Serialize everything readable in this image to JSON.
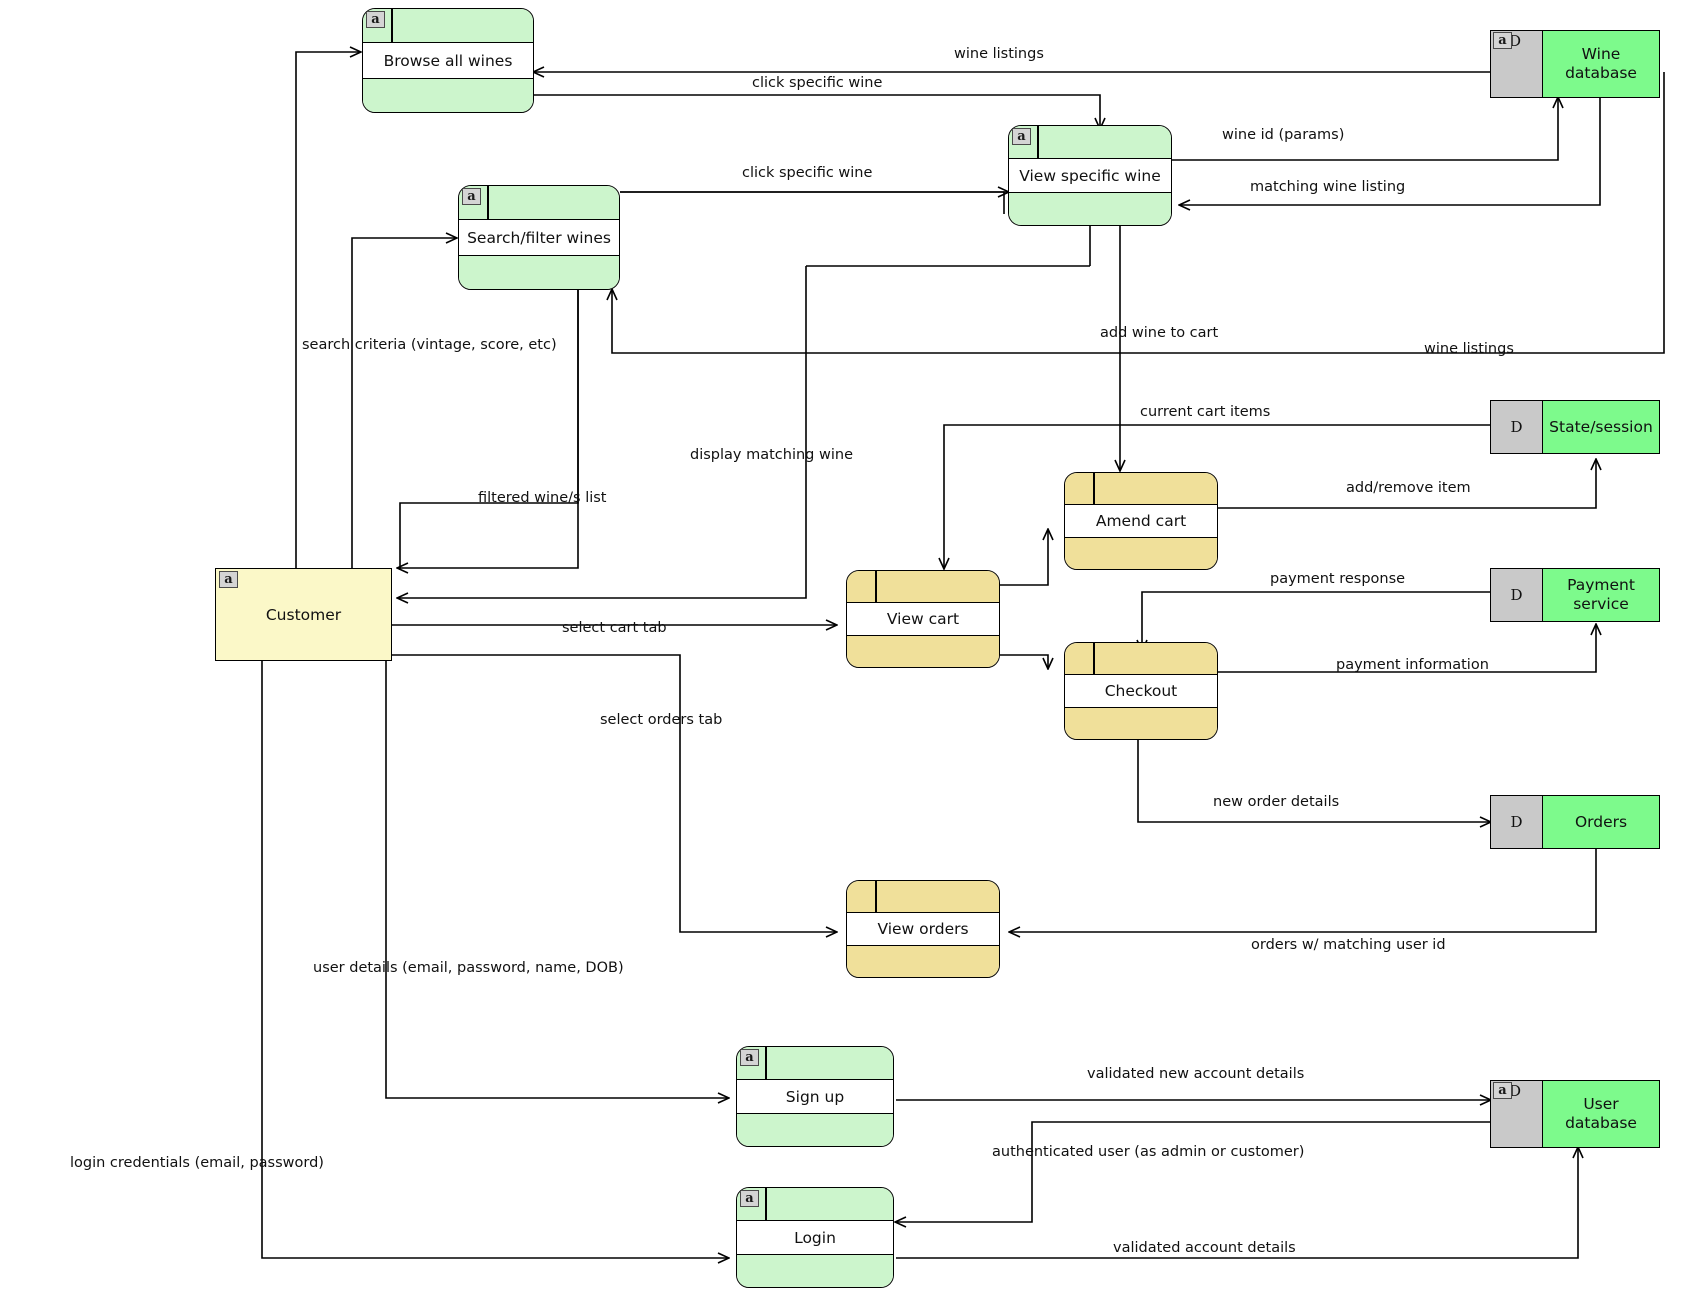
{
  "diagram": {
    "title": "Wine e-commerce data flow diagram",
    "colors": {
      "process_green": "#ccf5cc",
      "process_yellow": "#f0e09a",
      "entity_yellow": "#fbf8c8",
      "store_green": "#7dfa8c",
      "store_gray": "#c9c9c9",
      "line": "#000000"
    }
  },
  "entities": [
    {
      "id": "customer",
      "label": "Customer",
      "marker": "a"
    }
  ],
  "processes": [
    {
      "id": "browse",
      "label": "Browse all wines",
      "marker": "a",
      "color": "green"
    },
    {
      "id": "search",
      "label": "Search/filter wines",
      "marker": "a",
      "color": "green"
    },
    {
      "id": "viewwine",
      "label": "View specific wine",
      "marker": "a",
      "color": "green"
    },
    {
      "id": "viewcart",
      "label": "View cart",
      "marker": "",
      "color": "yellow"
    },
    {
      "id": "amend",
      "label": "Amend cart",
      "marker": "",
      "color": "yellow"
    },
    {
      "id": "checkout",
      "label": "Checkout",
      "marker": "",
      "color": "yellow"
    },
    {
      "id": "vieworders",
      "label": "View orders",
      "marker": "",
      "color": "yellow"
    },
    {
      "id": "signup",
      "label": "Sign up",
      "marker": "a",
      "color": "green"
    },
    {
      "id": "login",
      "label": "Login",
      "marker": "a",
      "color": "green"
    }
  ],
  "datastores": [
    {
      "id": "winedb",
      "label": "Wine\ndatabase",
      "line1": "Wine",
      "line2": "database",
      "dletter": "D",
      "marker": "a"
    },
    {
      "id": "state",
      "label": "State/session",
      "line1": "State/session",
      "line2": "",
      "dletter": "D",
      "marker": ""
    },
    {
      "id": "payment",
      "label": "Payment service",
      "line1": "Payment service",
      "line2": "",
      "dletter": "D",
      "marker": ""
    },
    {
      "id": "orders",
      "label": "Orders",
      "line1": "Orders",
      "line2": "",
      "dletter": "D",
      "marker": ""
    },
    {
      "id": "userdb",
      "label": "User\ndatabase",
      "line1": "User",
      "line2": "database",
      "dletter": "D",
      "marker": "a"
    }
  ],
  "flows": [
    {
      "id": "f01",
      "label": "wine listings"
    },
    {
      "id": "f02",
      "label": "click specific wine"
    },
    {
      "id": "f03",
      "label": "click specific wine"
    },
    {
      "id": "f04",
      "label": "wine id (params)"
    },
    {
      "id": "f05",
      "label": "matching wine listing"
    },
    {
      "id": "f06",
      "label": "search criteria (vintage, score, etc)"
    },
    {
      "id": "f07",
      "label": "add wine to cart"
    },
    {
      "id": "f08",
      "label": "wine listings"
    },
    {
      "id": "f09",
      "label": "display matching wine"
    },
    {
      "id": "f10",
      "label": "filtered wine/s list"
    },
    {
      "id": "f11",
      "label": "current cart items"
    },
    {
      "id": "f12",
      "label": "add/remove item"
    },
    {
      "id": "f13",
      "label": "payment response"
    },
    {
      "id": "f14",
      "label": "select cart tab"
    },
    {
      "id": "f15",
      "label": "payment information"
    },
    {
      "id": "f16",
      "label": "select orders tab"
    },
    {
      "id": "f17",
      "label": "new order details"
    },
    {
      "id": "f18",
      "label": "orders w/ matching user id"
    },
    {
      "id": "f19",
      "label": "user details (email, password, name, DOB)"
    },
    {
      "id": "f20",
      "label": "validated new account details"
    },
    {
      "id": "f21",
      "label": "authenticated user (as admin or customer)"
    },
    {
      "id": "f22",
      "label": "login credentials (email, password)"
    },
    {
      "id": "f23",
      "label": "validated account details"
    }
  ]
}
